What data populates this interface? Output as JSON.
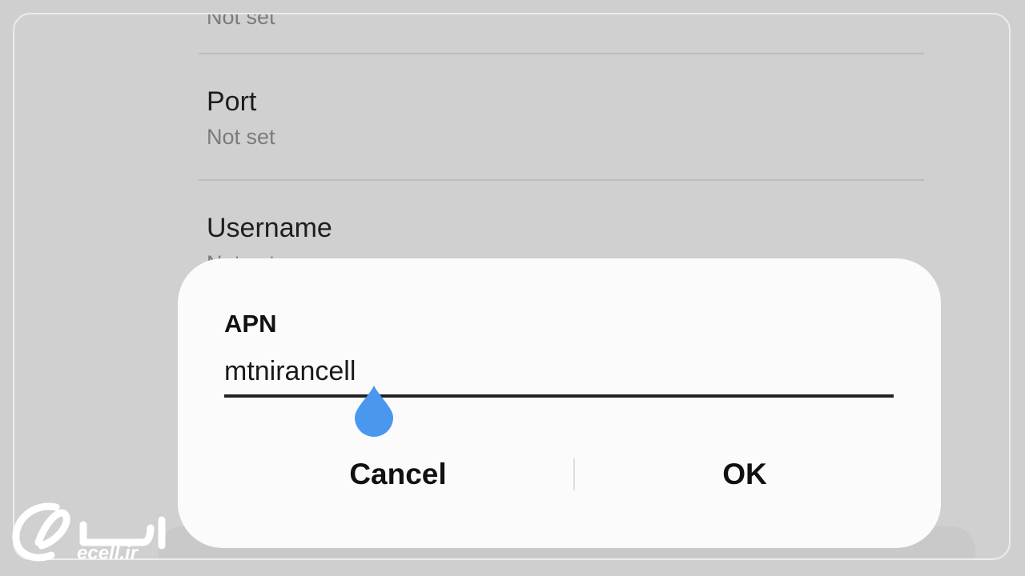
{
  "settings": {
    "prev_value": "Not set",
    "items": [
      {
        "title": "Port",
        "value": "Not set"
      },
      {
        "title": "Username",
        "value": "Not set"
      }
    ]
  },
  "dialog": {
    "label": "APN",
    "input_value": "mtnirancell",
    "cancel_label": "Cancel",
    "ok_label": "OK"
  },
  "watermark": {
    "brand": "ایسل",
    "domain": "ecell.ir"
  },
  "colors": {
    "cursor_handle": "#4a97f0",
    "dialog_bg": "#fbfbfb",
    "screen_bg": "#d0d0d0"
  }
}
